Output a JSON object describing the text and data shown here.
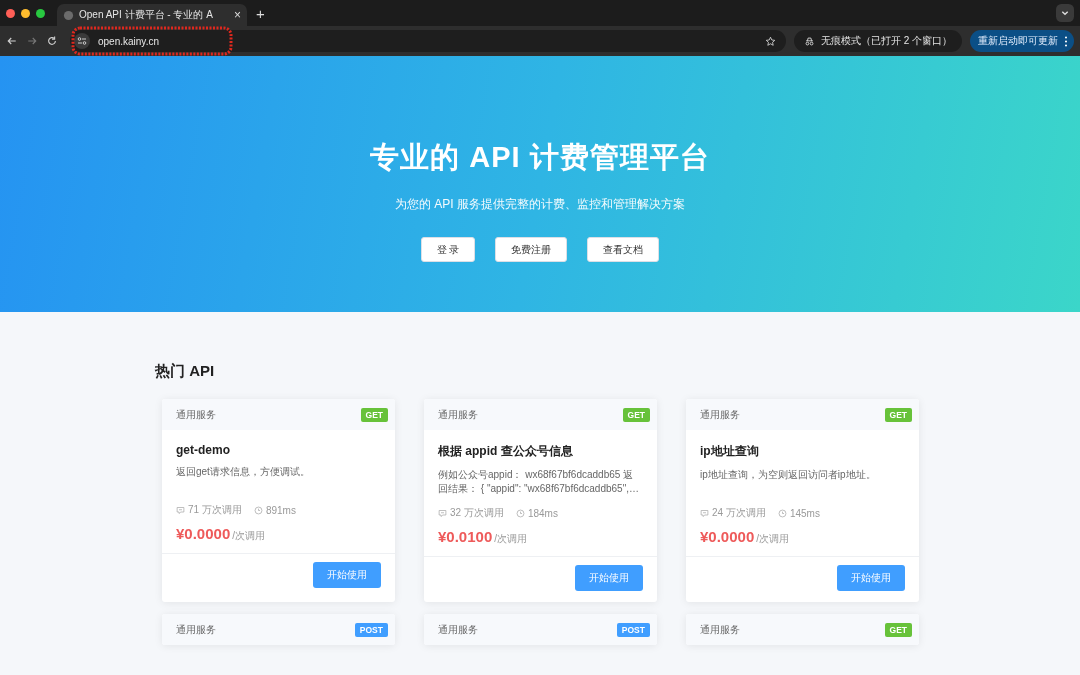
{
  "browser": {
    "tab": {
      "title": "Open API 计费平台 - 专业的 A",
      "close": "×"
    },
    "new_tab": "+",
    "url": "open.kainy.cn",
    "incognito": "无痕模式（已打开 2 个窗口）",
    "update_button": "重新启动即可更新"
  },
  "hero": {
    "title": "专业的 API 计费管理平台",
    "subtitle": "为您的 API 服务提供完整的计费、监控和管理解决方案",
    "buttons": [
      "登 录",
      "免费注册",
      "查看文档"
    ]
  },
  "section": {
    "title": "热门 API",
    "cards": [
      {
        "category": "通用服务",
        "method": "GET",
        "color": "#67c23a",
        "title": "get-demo",
        "description": "返回get请求信息，方便调试。",
        "calls": "71 万次调用",
        "latency": "891ms",
        "price": "¥0.0000",
        "unit": "/次调用",
        "button": "开始使用"
      },
      {
        "category": "通用服务",
        "method": "GET",
        "color": "#67c23a",
        "title": "根据 appid 查公众号信息",
        "description": "例如公众号appid： wx68f67bf6dcaddb65 返回结果： { \"appid\": \"wx68f67bf6dcaddb65\",…",
        "calls": "32 万次调用",
        "latency": "184ms",
        "price": "¥0.0100",
        "unit": "/次调用",
        "button": "开始使用"
      },
      {
        "category": "通用服务",
        "method": "GET",
        "color": "#67c23a",
        "title": "ip地址查询",
        "description": "ip地址查询，为空则返回访问者ip地址。",
        "calls": "24 万次调用",
        "latency": "145ms",
        "price": "¥0.0000",
        "unit": "/次调用",
        "button": "开始使用"
      },
      {
        "category": "通用服务",
        "method": "POST",
        "color": "#409eff"
      },
      {
        "category": "通用服务",
        "method": "POST",
        "color": "#409eff"
      },
      {
        "category": "通用服务",
        "method": "GET",
        "color": "#67c23a"
      }
    ]
  }
}
